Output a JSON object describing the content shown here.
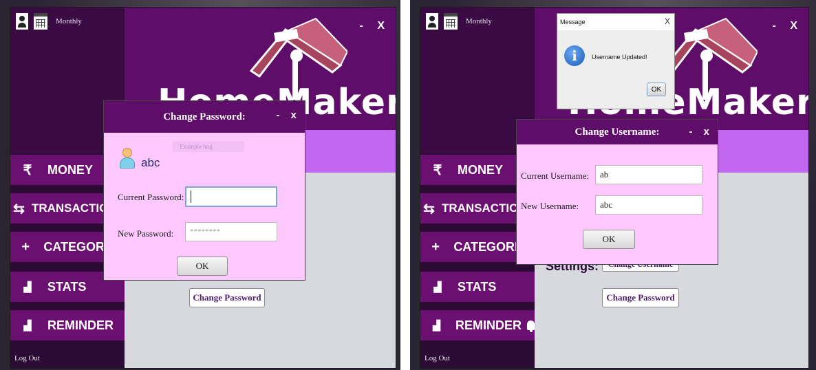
{
  "app": {
    "top_label": "Monthly",
    "brand": "HomeMaker",
    "minimize": "-",
    "close": "X",
    "logout": "Log Out",
    "settings_label": "Settings:"
  },
  "nav": [
    {
      "icon": "₹",
      "label": "MONEY"
    },
    {
      "icon": "⇆",
      "label": "TRANSACTIONS"
    },
    {
      "icon": "+",
      "label": "CATEGORIES"
    },
    {
      "icon": "▟",
      "label": "STATS"
    },
    {
      "icon": "▟",
      "label": "REMINDER"
    }
  ],
  "left_screen": {
    "background_button": "Change Password",
    "hidden_text": "Example hng",
    "dialog": {
      "title": "Change Password:",
      "minimize": "-",
      "close": "x",
      "username": "abc",
      "current_label": "Current Password:",
      "current_value": "",
      "new_label": "New Password:",
      "new_value": "********",
      "ok": "OK"
    }
  },
  "right_screen": {
    "background_button_1": "Change Username",
    "background_button_2": "Change Password",
    "dialog": {
      "title": "Change Username:",
      "minimize": "-",
      "close": "x",
      "current_label": "Current Username:",
      "current_value": "ab",
      "new_label": "New Username:",
      "new_value": "abc",
      "ok": "OK"
    },
    "message": {
      "title": "Message",
      "close": "X",
      "text": "Username Updated!",
      "ok": "OK"
    }
  },
  "colors": {
    "sidebar": "#2b0a33",
    "nav_item": "#6b1070",
    "header": "#5e0e68",
    "accent_strip": "#c267ef",
    "dialog_bg": "#ffc8ff"
  }
}
